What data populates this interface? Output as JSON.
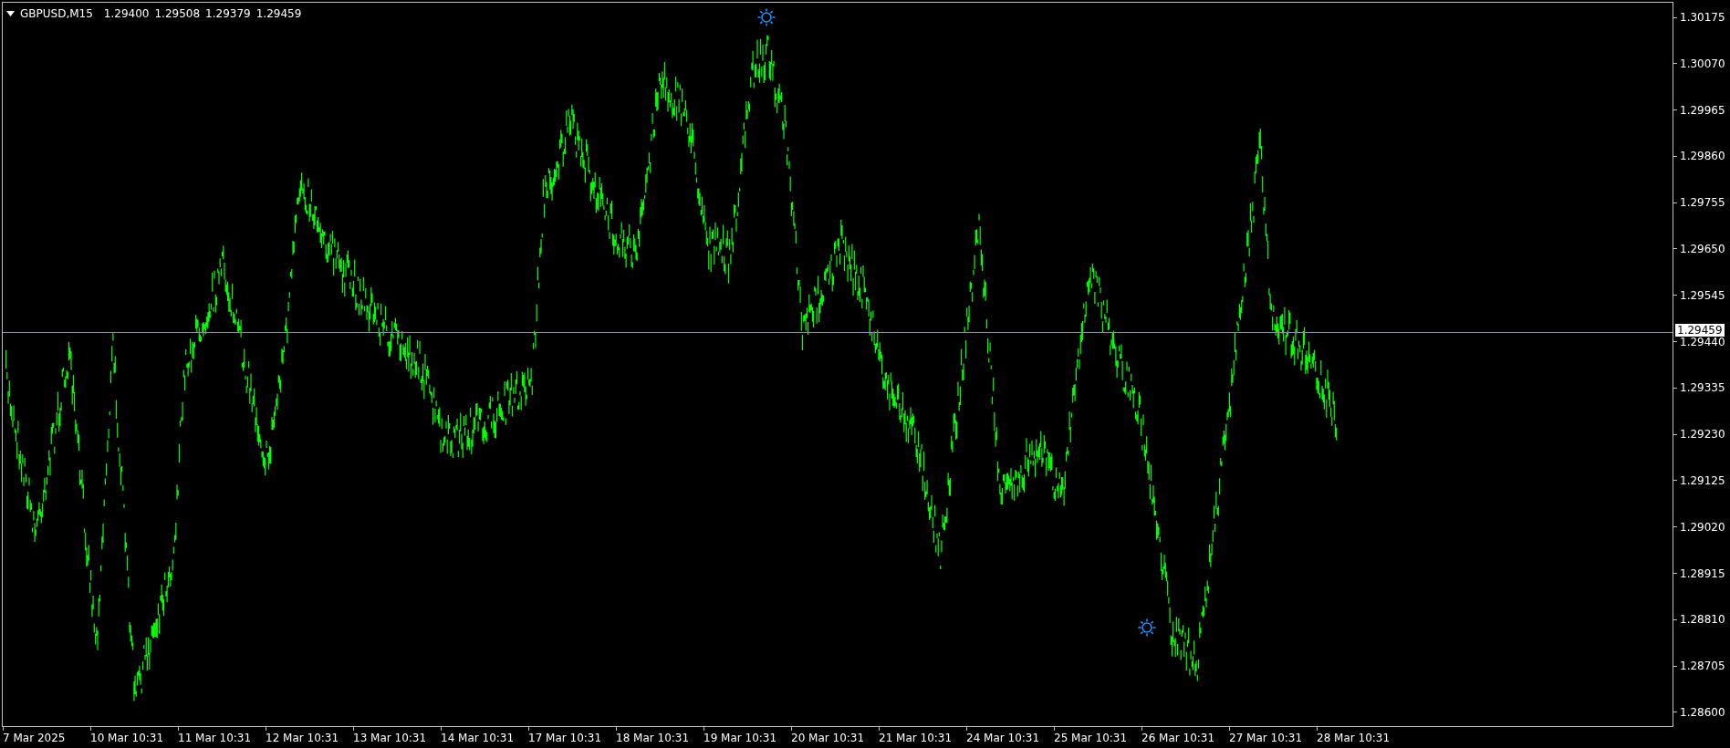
{
  "header": {
    "symbol": "GBPUSD,M15",
    "quotes": [
      "1.29400",
      "1.29508",
      "1.29379",
      "1.29459"
    ]
  },
  "price_axis": [
    "1.30175",
    "1.30070",
    "1.29965",
    "1.29860",
    "1.29755",
    "1.29650",
    "1.29545",
    "1.29440",
    "1.29335",
    "1.29230",
    "1.29125",
    "1.29020",
    "1.28915",
    "1.28810",
    "1.28705",
    "1.28600"
  ],
  "current_price": "1.29459",
  "time_axis": [
    "7 Mar 2025",
    "10 Mar 10:31",
    "11 Mar 10:31",
    "12 Mar 10:31",
    "13 Mar 10:31",
    "14 Mar 10:31",
    "17 Mar 10:31",
    "18 Mar 10:31",
    "19 Mar 10:31",
    "20 Mar 10:31",
    "21 Mar 10:31",
    "24 Mar 10:31",
    "25 Mar 10:31",
    "26 Mar 10:31",
    "27 Mar 10:31",
    "28 Mar 10:31"
  ]
}
